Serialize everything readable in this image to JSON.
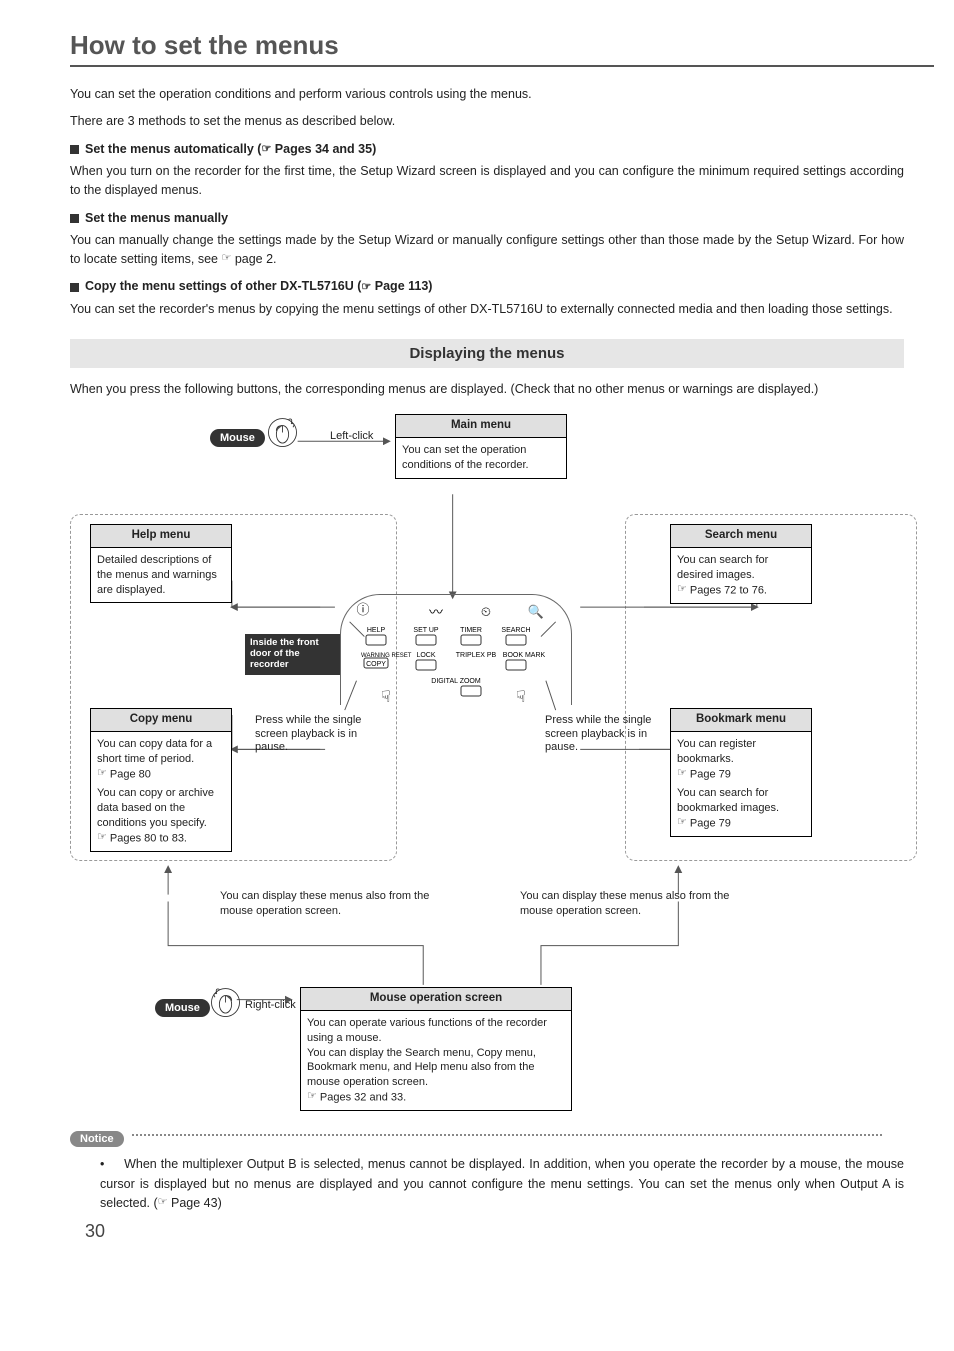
{
  "page": {
    "title": "How to set the menus",
    "intro1": "You can set the operation conditions and perform various controls using the menus.",
    "intro2": "There are 3 methods to set the menus as described below.",
    "pageNumber": "30"
  },
  "methods": {
    "auto": {
      "heading_prefix": "Set the menus automatically (",
      "heading_suffix": " Pages 34 and 35)",
      "body": "When you turn on the recorder for the first time, the Setup Wizard screen is displayed and you can configure the minimum required settings according to the displayed menus."
    },
    "manual": {
      "heading": "Set the menus manually",
      "body_prefix": "You can manually change the settings made by the Setup Wizard or manually configure settings other than those made by the Setup Wizard. For how to locate setting items, see ",
      "body_suffix": " page 2."
    },
    "copy": {
      "heading_prefix": "Copy the menu settings of other DX-TL5716U (",
      "heading_suffix": " Page 113)",
      "body": "You can set the recorder's menus by copying the menu settings of other DX-TL5716U to externally connected media and then loading those settings."
    }
  },
  "section": {
    "band": "Displaying the menus",
    "intro": "When you press the following buttons, the corresponding menus are displayed. (Check that no other menus or warnings are displayed.)"
  },
  "diagram": {
    "mouseLabel": "Mouse",
    "leftClick": "Left-click",
    "rightClick": "Right-click",
    "mainMenu": {
      "title": "Main menu",
      "body": "You can set the operation conditions of the recorder."
    },
    "helpMenu": {
      "title": "Help menu",
      "body": "Detailed descriptions of the menus and warnings are displayed."
    },
    "searchMenu": {
      "title": "Search menu",
      "body": "You can search for desired images.",
      "ref": " Pages 72 to 76."
    },
    "copyMenu": {
      "title": "Copy menu",
      "body1": "You can copy data for a short time of period.",
      "ref1": " Page 80",
      "body2": "You can copy or archive data based on the conditions you specify.",
      "ref2": " Pages 80 to 83."
    },
    "bookmarkMenu": {
      "title": "Bookmark menu",
      "body1": "You can register bookmarks.",
      "ref1": " Page 79",
      "body2": "You can search for bookmarked images.",
      "ref2": " Page 79"
    },
    "frontDoor": "Inside the front door of the recorder",
    "pressPause": "Press while the single screen playback is in pause.",
    "displayAlso": "You can display these menus also from the mouse operation screen.",
    "mouseOp": {
      "title": "Mouse operation screen",
      "body": "You can operate various functions of the recorder using a mouse.\nYou can display the Search menu, Copy menu, Bookmark menu, and Help menu also from the mouse operation screen.",
      "ref": " Pages 32 and 33."
    },
    "panelLabels": {
      "help": "HELP",
      "setup": "SET UP",
      "timer": "TIMER",
      "search": "SEARCH",
      "warning": "WARNING RESET",
      "copy": "COPY",
      "lock": "LOCK",
      "triplex": "TRIPLEX PB",
      "bookmark": "BOOK MARK",
      "zoom": "DIGITAL ZOOM"
    }
  },
  "notice": {
    "label": "Notice",
    "body_prefix": "When the multiplexer Output B is selected, menus cannot be displayed. In addition, when you operate the recorder by a mouse, the mouse cursor is displayed but no menus are displayed and you cannot configure the menu settings. You can set the menus only when Output A is selected. (",
    "body_suffix": " Page 43)"
  }
}
